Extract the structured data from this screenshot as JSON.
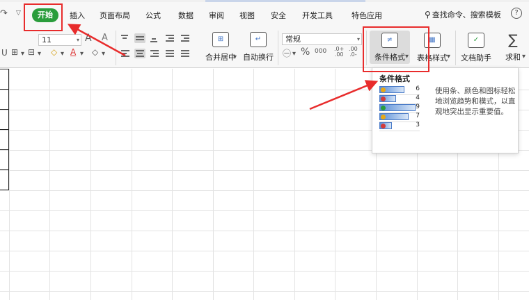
{
  "menubar": {
    "items": [
      {
        "label": "开始"
      },
      {
        "label": "插入"
      },
      {
        "label": "页面布局"
      },
      {
        "label": "公式"
      },
      {
        "label": "数据"
      },
      {
        "label": "审阅"
      },
      {
        "label": "视图"
      },
      {
        "label": "安全"
      },
      {
        "label": "开发工具"
      },
      {
        "label": "特色应用"
      }
    ],
    "search_label": "查找命令、搜索模板",
    "help": "?"
  },
  "ribbon": {
    "font_size": "11",
    "number_format": "常规",
    "merge_center_label": "合并居中",
    "wrap_text_label": "自动换行",
    "conditional_format_label": "条件格式",
    "table_style_label": "表格样式",
    "doc_assistant_label": "文档助手",
    "sum_label": "求和"
  },
  "tooltip": {
    "title": "条件格式",
    "description": "使用条、颜色和图标轻松地浏览趋势和模式，以直观地突出显示重要值。",
    "preview_values": [
      "6",
      "4",
      "9",
      "7",
      "3"
    ]
  },
  "colors": {
    "accent_green": "#2a9d3c",
    "annotation_red": "#e82c2c",
    "bar_blue": "#5a8fd8"
  }
}
